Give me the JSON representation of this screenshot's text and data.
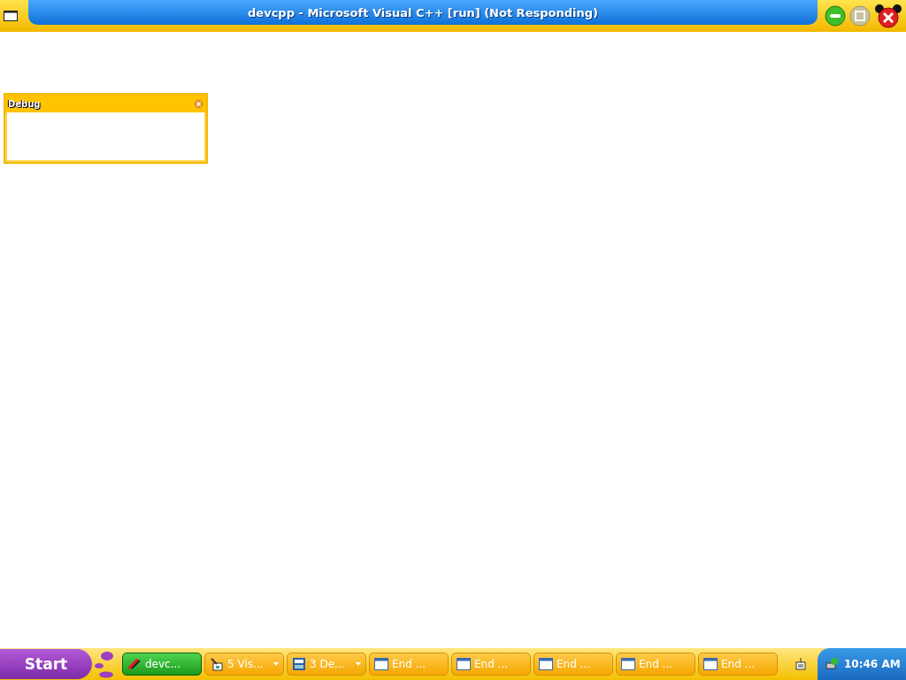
{
  "window": {
    "title": "devcpp - Microsoft Visual C++ [run] (Not Responding)"
  },
  "debug_panel": {
    "title": "Debug"
  },
  "taskbar": {
    "start": "Start",
    "items": [
      {
        "label": "devc...",
        "kind": "app",
        "selected": true
      },
      {
        "label": "5 Vis...",
        "kind": "tools",
        "selected": false
      },
      {
        "label": "3 De...",
        "kind": "docs",
        "selected": false
      },
      {
        "label": "End ...",
        "kind": "window",
        "selected": false
      },
      {
        "label": "End ...",
        "kind": "window",
        "selected": false
      },
      {
        "label": "End ...",
        "kind": "window",
        "selected": false
      },
      {
        "label": "End ...",
        "kind": "window",
        "selected": false
      },
      {
        "label": "End ...",
        "kind": "window",
        "selected": false
      }
    ],
    "clock": "10:46 AM"
  }
}
